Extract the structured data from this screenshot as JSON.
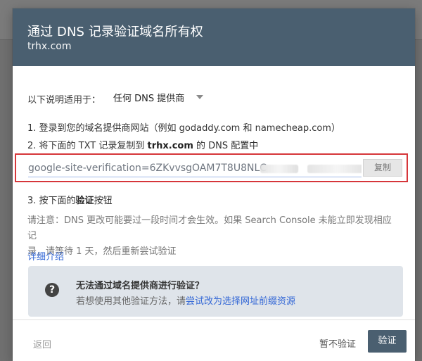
{
  "dialog": {
    "title": "通过 DNS 记录验证域名所有权",
    "subtitle": "trhx.com"
  },
  "instructions": {
    "applies_to_label": "以下说明适用于：",
    "provider_value": "任何 DNS 提供商",
    "step1": "1. 登录到您的域名提供商网站（例如 godaddy.com 和 namecheap.com）",
    "step2_prefix": "2. 将下面的 TXT 记录复制到 ",
    "step2_domain": "trhx.com",
    "step2_suffix": " 的 DNS 配置中",
    "verification_value": "google-site-verification=6ZKvvsgOAM7T8U8NLC",
    "copy_button": "复制",
    "step3_prefix": "3. 按下面的",
    "step3_bold": "验证",
    "step3_suffix": "按钮"
  },
  "notice": {
    "line1": "请注意：DNS 更改可能要过一段时间才会生效。如果 Search Console 未能立即发现相应记",
    "line2": "录，请等待 1 天，然后重新尝试验证",
    "details_link": "详细介绍"
  },
  "help_panel": {
    "icon": "help-circle-icon",
    "title": "无法通过域名提供商进行验证？",
    "text_prefix": "若想使用其他验证方法，请",
    "link": "尝试改为选择网址前缀资源"
  },
  "footer": {
    "back": "返回",
    "later": "暂不验证",
    "verify": "验证"
  },
  "colors": {
    "header": "#4a5f70",
    "link": "#3367d6",
    "highlight": "#d6363a"
  }
}
